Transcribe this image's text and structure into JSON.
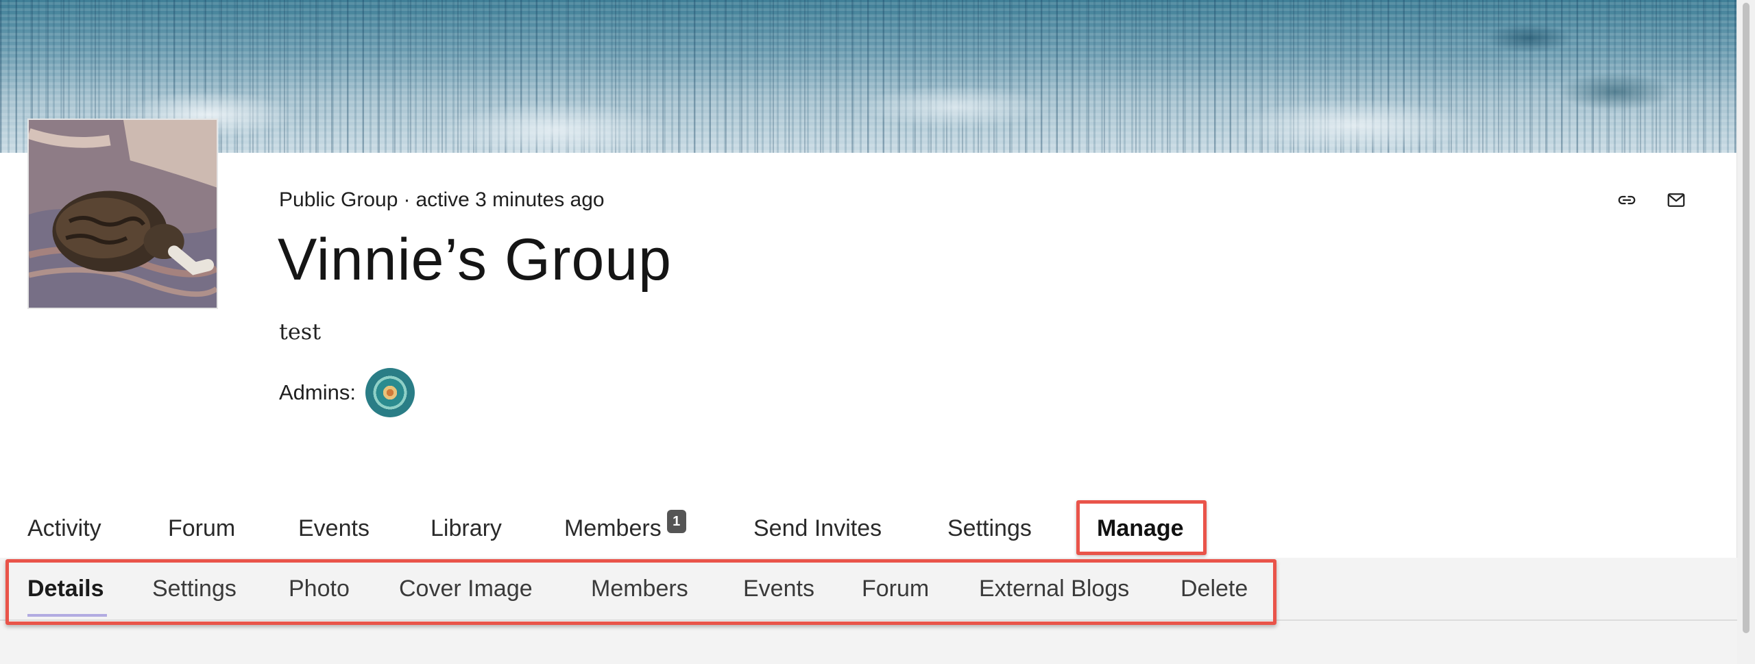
{
  "group": {
    "status": "Public Group",
    "separator": "·",
    "activity": "active 3 minutes ago",
    "title": "Vinnie’s Group",
    "description": "test",
    "admins_label": "Admins:"
  },
  "header_actions": [
    {
      "icon": "link-icon"
    },
    {
      "icon": "mail-icon"
    }
  ],
  "main_nav": {
    "items": [
      {
        "label": "Activity"
      },
      {
        "label": "Forum"
      },
      {
        "label": "Events"
      },
      {
        "label": "Library"
      },
      {
        "label": "Members",
        "badge": "1"
      },
      {
        "label": "Send Invites"
      },
      {
        "label": "Settings"
      },
      {
        "label": "Manage",
        "active": true
      }
    ]
  },
  "sub_nav": {
    "items": [
      {
        "label": "Details",
        "active": true
      },
      {
        "label": "Settings"
      },
      {
        "label": "Photo"
      },
      {
        "label": "Cover Image"
      },
      {
        "label": "Members"
      },
      {
        "label": "Events"
      },
      {
        "label": "Forum"
      },
      {
        "label": "External Blogs"
      },
      {
        "label": "Delete"
      }
    ]
  },
  "colors": {
    "highlight_border": "#e9544a",
    "badge_bg": "#555555",
    "subnav_bg": "#f3f3f3"
  }
}
